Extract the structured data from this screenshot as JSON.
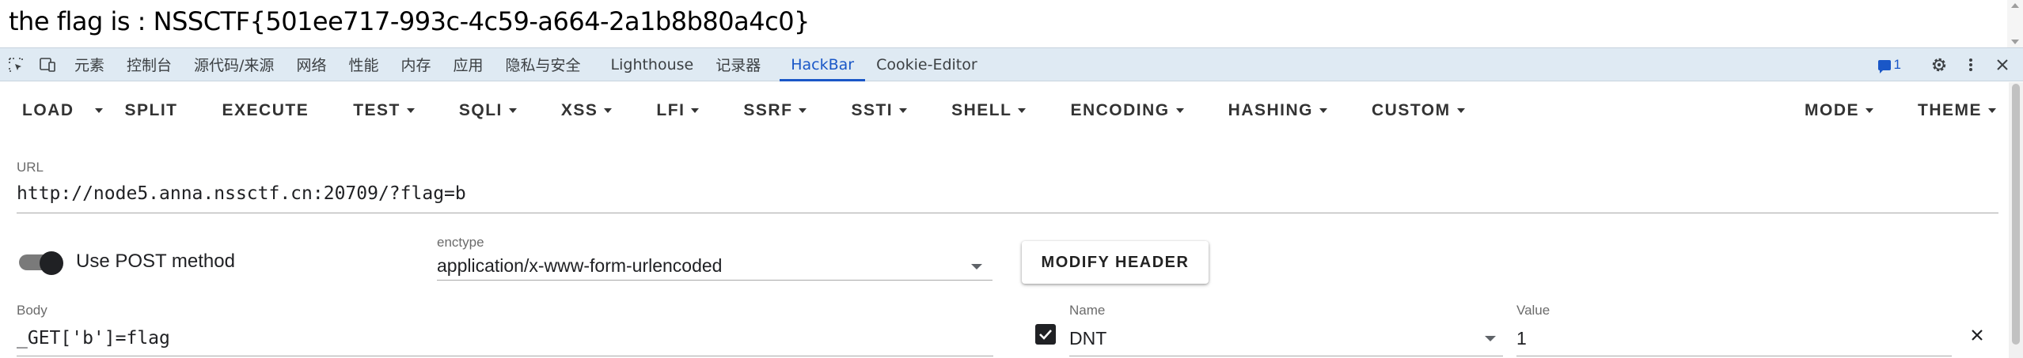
{
  "page": {
    "flag_text": "the flag is : NSSCTF{501ee717-993c-4c59-a664-2a1b8b80a4c0}"
  },
  "devtools": {
    "tabs": [
      {
        "label": "元素"
      },
      {
        "label": "控制台"
      },
      {
        "label": "源代码/来源"
      },
      {
        "label": "网络"
      },
      {
        "label": "性能"
      },
      {
        "label": "内存"
      },
      {
        "label": "应用"
      },
      {
        "label": "隐私与安全"
      },
      {
        "label": "Lighthouse"
      },
      {
        "label": "记录器"
      },
      {
        "label": "HackBar",
        "active": true
      },
      {
        "label": "Cookie-Editor"
      }
    ],
    "issues_count": "1",
    "accent_color": "#1a57c7"
  },
  "hackbar": {
    "toolbar": {
      "load": "LOAD",
      "split": "SPLIT",
      "execute": "EXECUTE",
      "test": "TEST",
      "sqli": "SQLI",
      "xss": "XSS",
      "lfi": "LFI",
      "ssrf": "SSRF",
      "ssti": "SSTI",
      "shell": "SHELL",
      "encoding": "ENCODING",
      "hashing": "HASHING",
      "custom": "CUSTOM",
      "mode": "MODE",
      "theme": "THEME"
    },
    "url": {
      "label": "URL",
      "value": "http://node5.anna.nssctf.cn:20709/?flag=b"
    },
    "post": {
      "toggle_label": "Use POST method",
      "enabled": true
    },
    "enctype": {
      "label": "enctype",
      "value": "application/x-www-form-urlencoded"
    },
    "modify_header": "MODIFY HEADER",
    "body": {
      "label": "Body",
      "value": "_GET['b']=flag"
    },
    "header": {
      "checked": true,
      "name_label": "Name",
      "name_value": "DNT",
      "value_label": "Value",
      "value_value": "1"
    }
  }
}
